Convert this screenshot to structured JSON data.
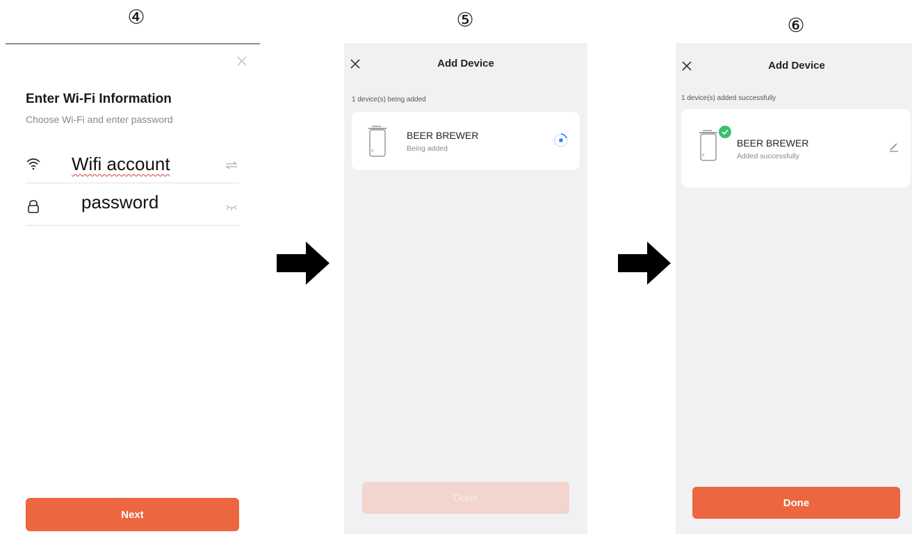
{
  "steps": [
    "④",
    "⑤",
    "⑥"
  ],
  "wifi_screen": {
    "title": "Enter Wi-Fi Information",
    "subtitle": "Choose Wi-Fi and enter password",
    "wifi_value": "Wifi account",
    "password_value": "password",
    "next_label": "Next",
    "icons": [
      "close-icon",
      "wifi-icon",
      "swap-icon",
      "lock-icon",
      "eye-closed-icon"
    ]
  },
  "adding_screen": {
    "title": "Add Device",
    "status": "1 device(s) being added",
    "device_name": "BEER BREWER",
    "device_status": "Being added",
    "done_label": "Done"
  },
  "success_screen": {
    "title": "Add Device",
    "status": "1 device(s) added successfully",
    "device_name": "BEER BREWER",
    "device_status": "Added successfully",
    "done_label": "Done"
  },
  "colors": {
    "accent": "#ec6640",
    "accent_disabled": "#f2d5cf",
    "success_green": "#3bbf6a",
    "progress_blue": "#2f7cf6",
    "panel_gray": "#f1f1f3"
  }
}
